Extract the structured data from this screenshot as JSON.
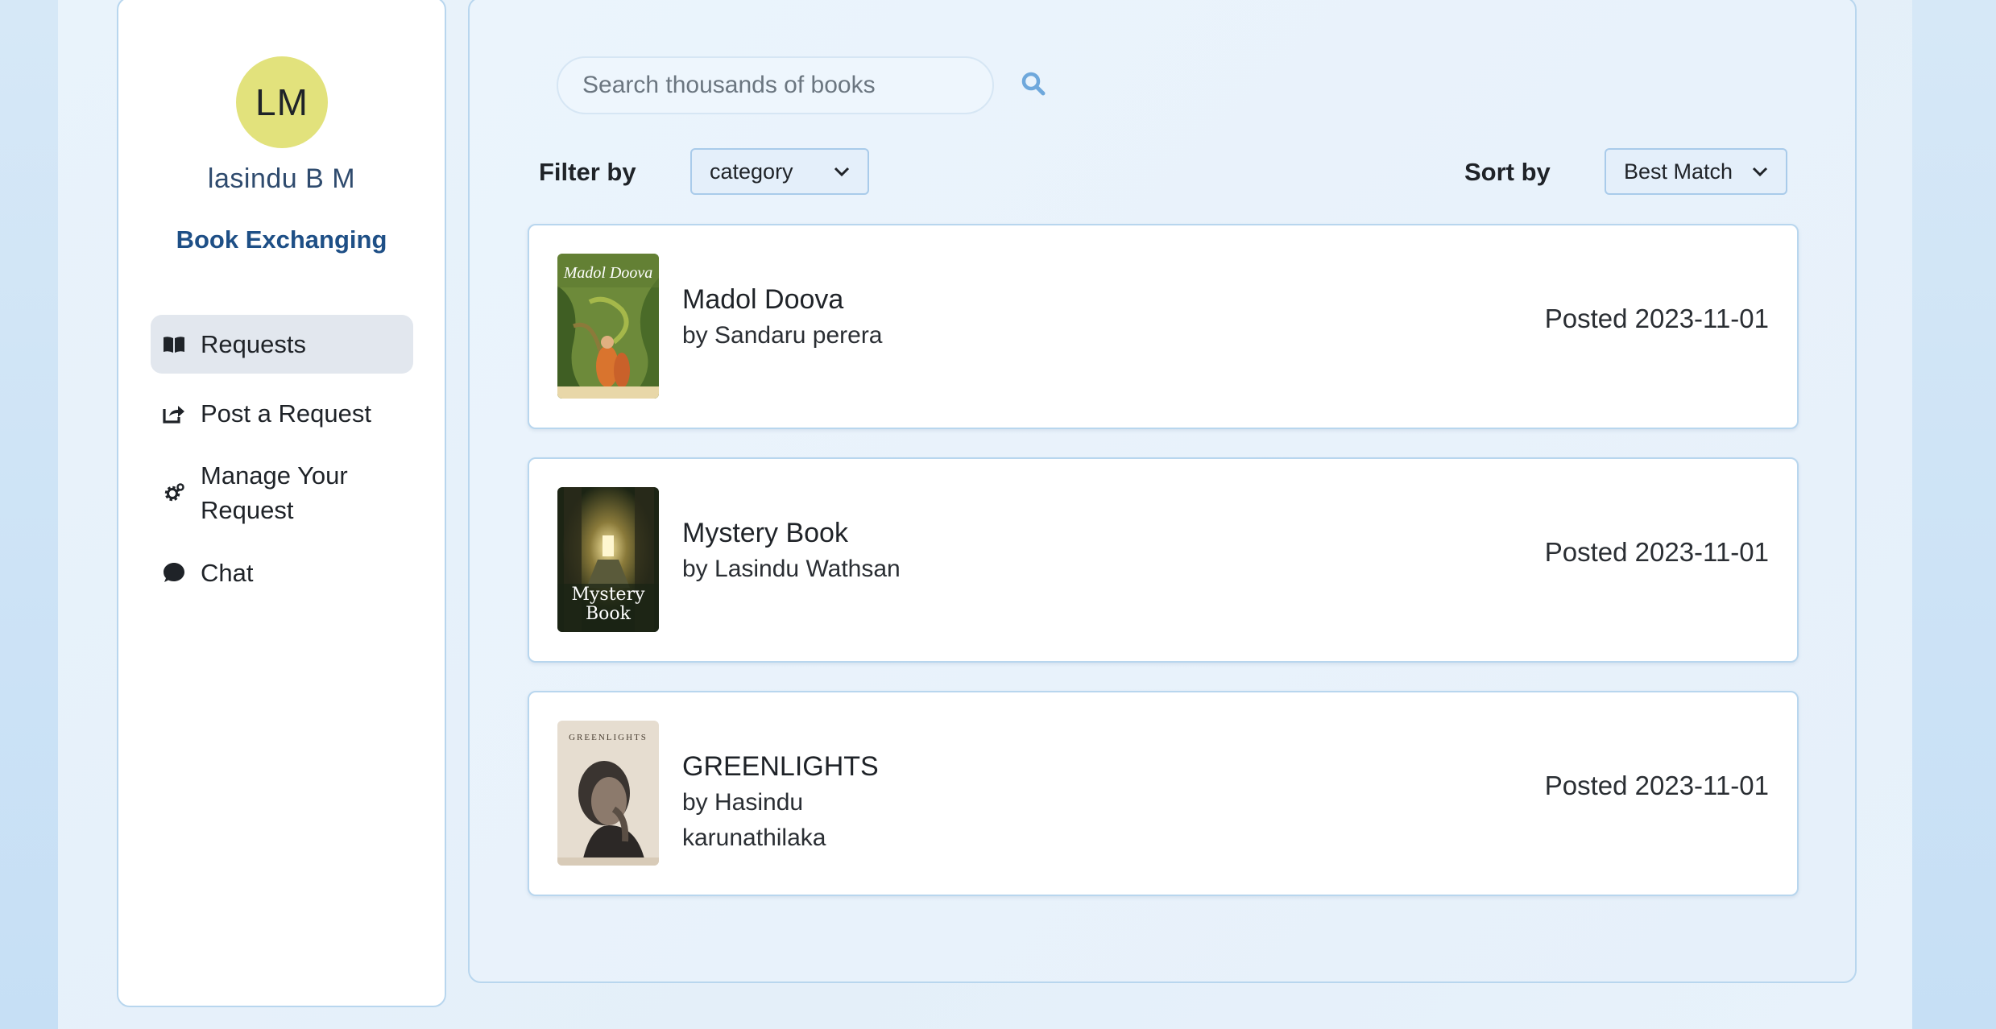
{
  "profile": {
    "initials": "LM",
    "name": "lasindu B M",
    "app_title": "Book Exchanging"
  },
  "nav": [
    {
      "label": "Requests",
      "icon": "open-book-icon",
      "active": true
    },
    {
      "label": "Post a Request",
      "icon": "share-icon",
      "active": false
    },
    {
      "label": "Manage Your Request",
      "icon": "gear-icon",
      "active": false
    },
    {
      "label": "Chat",
      "icon": "chat-bubble-icon",
      "active": false
    }
  ],
  "search": {
    "placeholder": "Search thousands of books"
  },
  "filter": {
    "label": "Filter by",
    "selected": "category"
  },
  "sort": {
    "label": "Sort by",
    "selected": "Best Match"
  },
  "books": [
    {
      "title": "Madol Doova",
      "author": "by Sandaru perera",
      "posted": "Posted 2023-11-01",
      "cover_title": "Madol Doova"
    },
    {
      "title": "Mystery Book",
      "author": "by Lasindu Wathsan",
      "posted": "Posted 2023-11-01",
      "cover_title": "Mystery Book"
    },
    {
      "title": "GREENLIGHTS",
      "author": "by Hasindu karunathilaka",
      "posted": "Posted 2023-11-01",
      "cover_title": "GREENLIGHTS"
    }
  ],
  "colors": {
    "avatar_bg": "#e2e27c",
    "accent_blue": "#1e4f86",
    "search_icon": "#6fa8dc",
    "border": "#b8d6ee"
  }
}
